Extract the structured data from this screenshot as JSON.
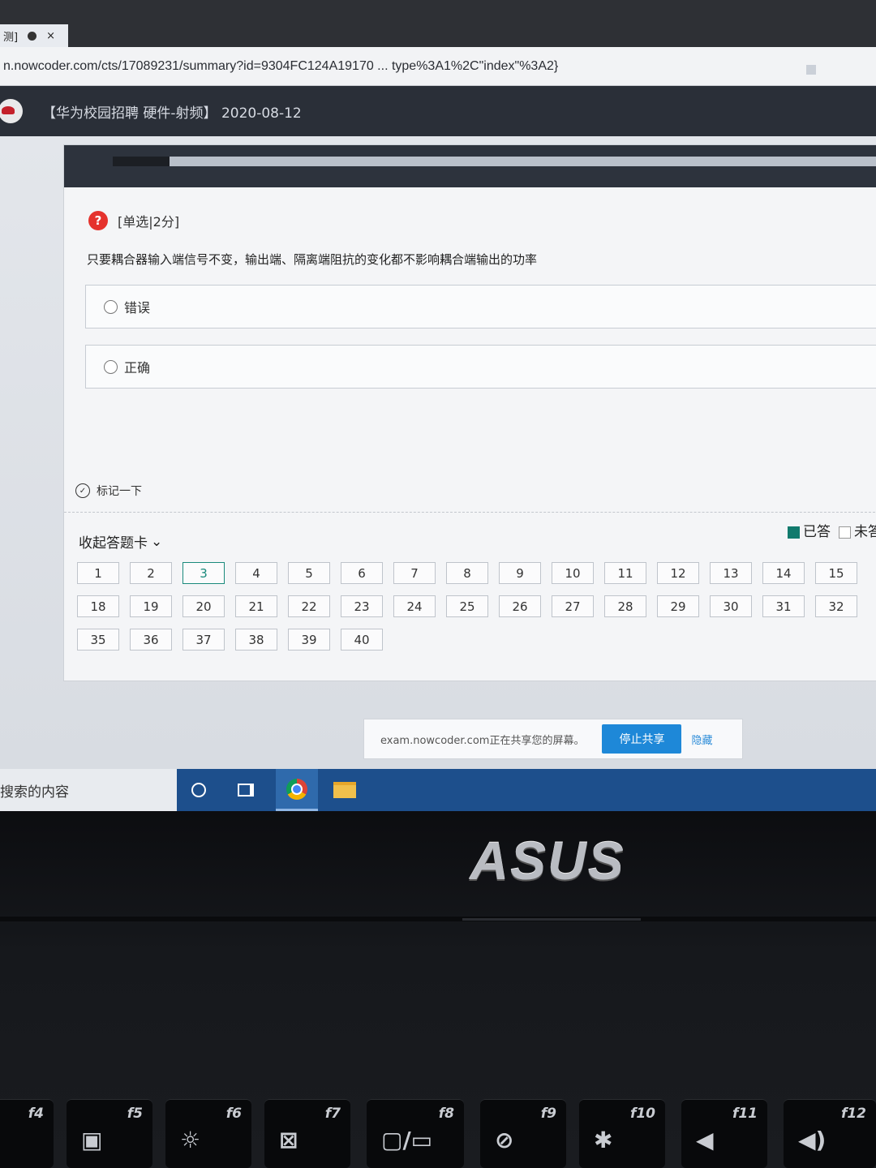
{
  "browser": {
    "tab_label": "测]",
    "tab_close": "×",
    "url": "n.nowcoder.com/cts/17089231/summary?id=9304FC124A19170 ... type%3A1%2C\"index\"%3A2}"
  },
  "site": {
    "exam_title": "【华为校园招聘 硬件-射频】 2020-08-12"
  },
  "question": {
    "icon": "?",
    "type_label": "[单选|2分]",
    "text": "只要耦合器输入端信号不变，输出端、隔离端阻抗的变化都不影响耦合端输出的功率",
    "options": [
      {
        "label": "错误"
      },
      {
        "label": "正确"
      }
    ],
    "progress_fraction": 0.07
  },
  "mark": {
    "label": "标记一下"
  },
  "answer_sheet": {
    "toggle_label": "收起答题卡",
    "legend_done": "已答",
    "legend_todo": "未答",
    "current": "3",
    "rows": [
      [
        "1",
        "2",
        "3",
        "4",
        "5",
        "6",
        "7",
        "8",
        "9",
        "10",
        "11",
        "12",
        "13",
        "14",
        "15"
      ],
      [
        "18",
        "19",
        "20",
        "21",
        "22",
        "23",
        "24",
        "25",
        "26",
        "27",
        "28",
        "29",
        "30",
        "31",
        "32"
      ],
      [
        "35",
        "36",
        "37",
        "38",
        "39",
        "40"
      ]
    ]
  },
  "share": {
    "message": "exam.nowcoder.com正在共享您的屏幕。",
    "stop_label": "停止共享",
    "hide_label": "隐藏"
  },
  "taskbar": {
    "search_placeholder": "搜索的内容"
  },
  "laptop": {
    "brand": "ASUS",
    "keys": [
      {
        "fn": "f4"
      },
      {
        "fn": "f5"
      },
      {
        "fn": "f6"
      },
      {
        "fn": "f7"
      },
      {
        "fn": "f8"
      },
      {
        "fn": "f9"
      },
      {
        "fn": "f10"
      },
      {
        "fn": "f11"
      },
      {
        "fn": "f12"
      }
    ]
  }
}
